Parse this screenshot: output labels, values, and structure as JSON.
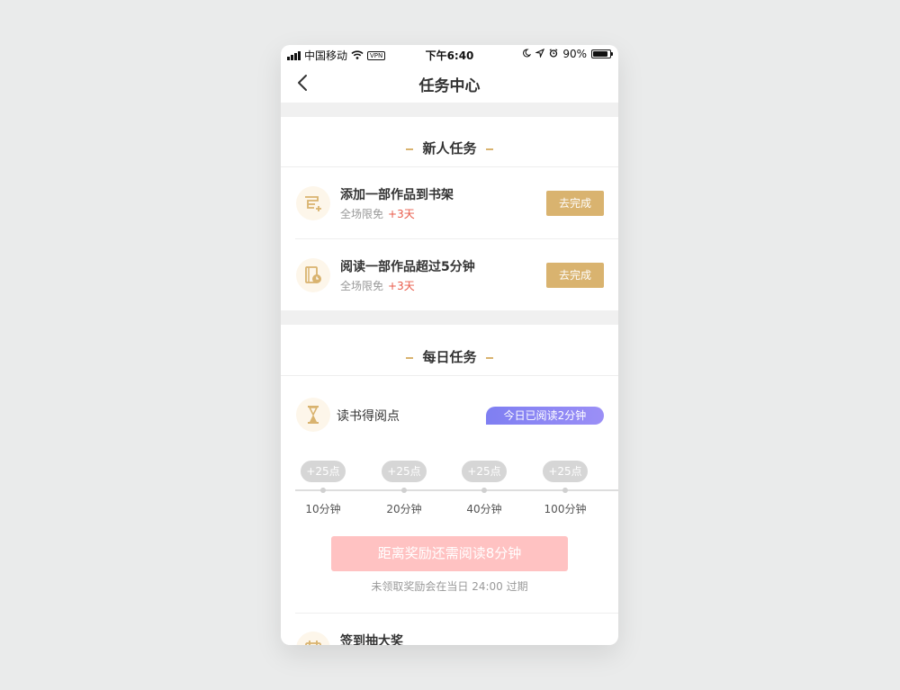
{
  "status_bar": {
    "carrier": "中国移动",
    "vpn": "VPN",
    "time": "下午6:40",
    "battery": "90%",
    "battery_level": 0.9,
    "icons": [
      "signal-icon",
      "wifi-icon",
      "moon-icon",
      "location-icon",
      "alarm-icon",
      "battery-icon"
    ]
  },
  "nav": {
    "title": "任务中心",
    "back_icon": "chevron-left-icon"
  },
  "new_user_section": {
    "title": "新人任务",
    "tasks": [
      {
        "name": "添加一部作品到书架",
        "sub": "全场限免",
        "reward": "+3天",
        "button": "去完成",
        "icon": "bookshelf-add-icon"
      },
      {
        "name": "阅读一部作品超过5分钟",
        "sub": "全场限免",
        "reward": "+3天",
        "button": "去完成",
        "icon": "book-timer-icon"
      }
    ]
  },
  "daily_section": {
    "title": "每日任务",
    "read_task": {
      "name": "读书得阅点",
      "badge": "今日已阅读2分钟",
      "icon": "hourglass-icon",
      "milestones": [
        {
          "reward": "+25点",
          "label": "10分钟"
        },
        {
          "reward": "+25点",
          "label": "20分钟"
        },
        {
          "reward": "+25点",
          "label": "40分钟"
        },
        {
          "reward": "+25点",
          "label": "100分钟"
        }
      ],
      "progress_button": "距离奖励还需阅读8分钟",
      "expire_note": "未领取奖励会在当日 24:00 过期"
    },
    "signin_task": {
      "name": "签到抽大奖",
      "icon": "calendar-icon"
    }
  },
  "colors": {
    "accent_gold": "#d9b36f",
    "reward_red": "#e95b4a",
    "badge_purple": "#8a86f4",
    "progress_pink": "#ffc2c2"
  }
}
